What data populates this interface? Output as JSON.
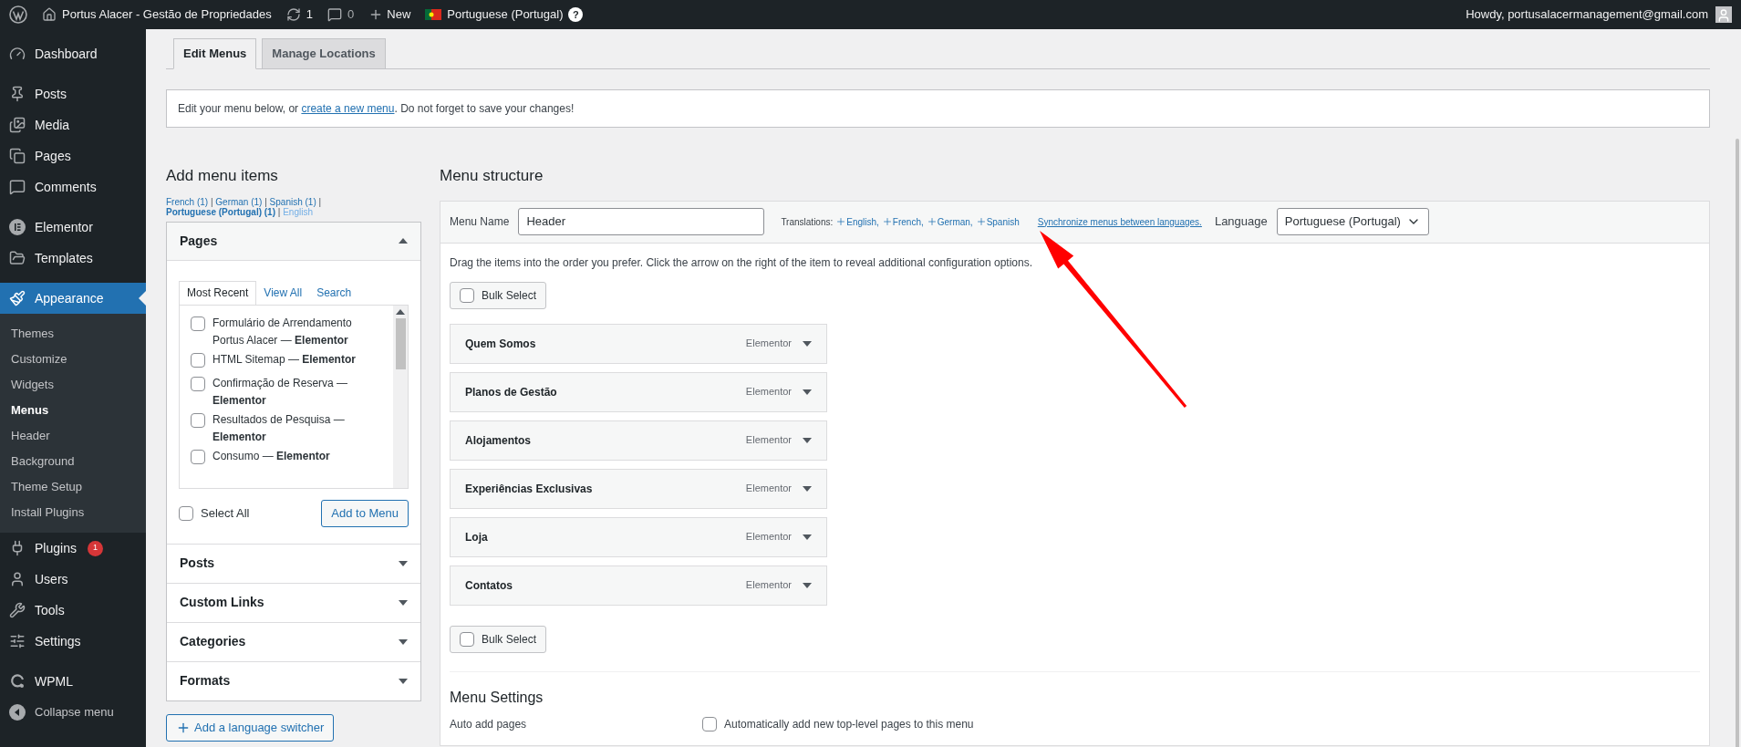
{
  "admin_bar": {
    "site_title": "Portus Alacer - Gestão de Propriedades",
    "updates_count": "1",
    "comments_count": "0",
    "new_label": "New",
    "language": "Portuguese (Portugal)",
    "help": "?",
    "greeting": "Howdy, portusalacermanagement@gmail.com"
  },
  "sidebar": {
    "groups": [
      {
        "items": [
          {
            "label": "Dashboard",
            "selected": false
          }
        ]
      },
      {
        "items": [
          {
            "label": "Posts",
            "selected": false
          },
          {
            "label": "Media",
            "selected": false
          },
          {
            "label": "Pages",
            "selected": false
          },
          {
            "label": "Comments",
            "selected": false
          }
        ]
      },
      {
        "items": [
          {
            "label": "Elementor",
            "selected": false
          },
          {
            "label": "Templates",
            "selected": false
          }
        ]
      },
      {
        "items": [
          {
            "label": "Appearance",
            "selected": true,
            "children": [
              {
                "label": "Themes",
                "selected": false
              },
              {
                "label": "Customize",
                "selected": false
              },
              {
                "label": "Widgets",
                "selected": false
              },
              {
                "label": "Menus",
                "selected": true
              },
              {
                "label": "Header",
                "selected": false
              },
              {
                "label": "Background",
                "selected": false
              },
              {
                "label": "Theme Setup",
                "selected": false
              },
              {
                "label": "Install Plugins",
                "selected": false
              }
            ]
          },
          {
            "label": "Plugins",
            "selected": false,
            "badge": "1"
          },
          {
            "label": "Users",
            "selected": false
          },
          {
            "label": "Tools",
            "selected": false
          },
          {
            "label": "Settings",
            "selected": false
          }
        ]
      },
      {
        "items": [
          {
            "label": "WPML",
            "selected": false
          },
          {
            "label": "Collapse menu",
            "selected": false
          }
        ]
      }
    ]
  },
  "tabs": [
    {
      "label": "Edit Menus",
      "selected": true
    },
    {
      "label": "Manage Locations",
      "selected": false
    }
  ],
  "notice": {
    "before": "Edit your menu below, or ",
    "link": "create a new menu",
    "after": ". Do not forget to save your changes!"
  },
  "add_items": {
    "title": "Add menu items",
    "separator": "|",
    "languages": [
      {
        "label": "French (1)",
        "selected": false
      },
      {
        "label": "German (1)",
        "selected": false
      },
      {
        "label": "Spanish (1)",
        "selected": false
      },
      {
        "label": "Portuguese (Portugal) (1)",
        "selected": true
      },
      {
        "label": "English",
        "selected": false
      }
    ],
    "sections": [
      {
        "title": "Pages",
        "expanded": true
      },
      {
        "title": "Posts",
        "expanded": false
      },
      {
        "title": "Custom Links",
        "expanded": false
      },
      {
        "title": "Categories",
        "expanded": false
      },
      {
        "title": "Formats",
        "expanded": false
      }
    ],
    "pages": {
      "tabs": [
        {
          "label": "Most Recent",
          "selected": true
        },
        {
          "label": "View All",
          "selected": false
        },
        {
          "label": "Search",
          "selected": false
        }
      ],
      "items": [
        {
          "label": "Formulário de Arrendamento Portus Alacer — **Elementor**",
          "checked": false
        },
        {
          "label": "HTML Sitemap — **Elementor**",
          "checked": false
        },
        {
          "label": "Confirmação de Reserva — **Elementor**",
          "checked": false
        },
        {
          "label": "Resultados de Pesquisa — **Elementor**",
          "checked": false
        },
        {
          "label": "Consumo — **Elementor**",
          "checked": false
        }
      ],
      "select_all": {
        "label": "Select All",
        "checked": false
      },
      "add_button": "Add to Menu"
    },
    "language_switcher_button": "Add a language switcher"
  },
  "menu_structure": {
    "title": "Menu structure",
    "menu_name_label": "Menu Name",
    "menu_name_value": "Header",
    "translations_label": "Translations:",
    "translations": [
      "English,",
      "French,",
      "German,",
      "Spanish"
    ],
    "sync_link": "Synchronize menus between languages.",
    "language_label": "Language",
    "language_value": "Portuguese (Portugal)",
    "instructions": "Drag the items into the order you prefer. Click the arrow on the right of the item to reveal additional configuration options.",
    "bulk_select": [
      {
        "label": "Bulk Select",
        "checked": false
      },
      {
        "label": "Bulk Select",
        "checked": false
      }
    ],
    "items": [
      {
        "title": "Quem Somos",
        "type": "Elementor"
      },
      {
        "title": "Planos de Gestão",
        "type": "Elementor"
      },
      {
        "title": "Alojamentos",
        "type": "Elementor"
      },
      {
        "title": "Experiências Exclusivas",
        "type": "Elementor"
      },
      {
        "title": "Loja",
        "type": "Elementor"
      },
      {
        "title": "Contatos",
        "type": "Elementor"
      }
    ],
    "settings": {
      "title": "Menu Settings",
      "auto_add_label": "Auto add pages",
      "auto_add_option": "Automatically add new top-level pages to this menu",
      "auto_add_checked": false
    }
  }
}
